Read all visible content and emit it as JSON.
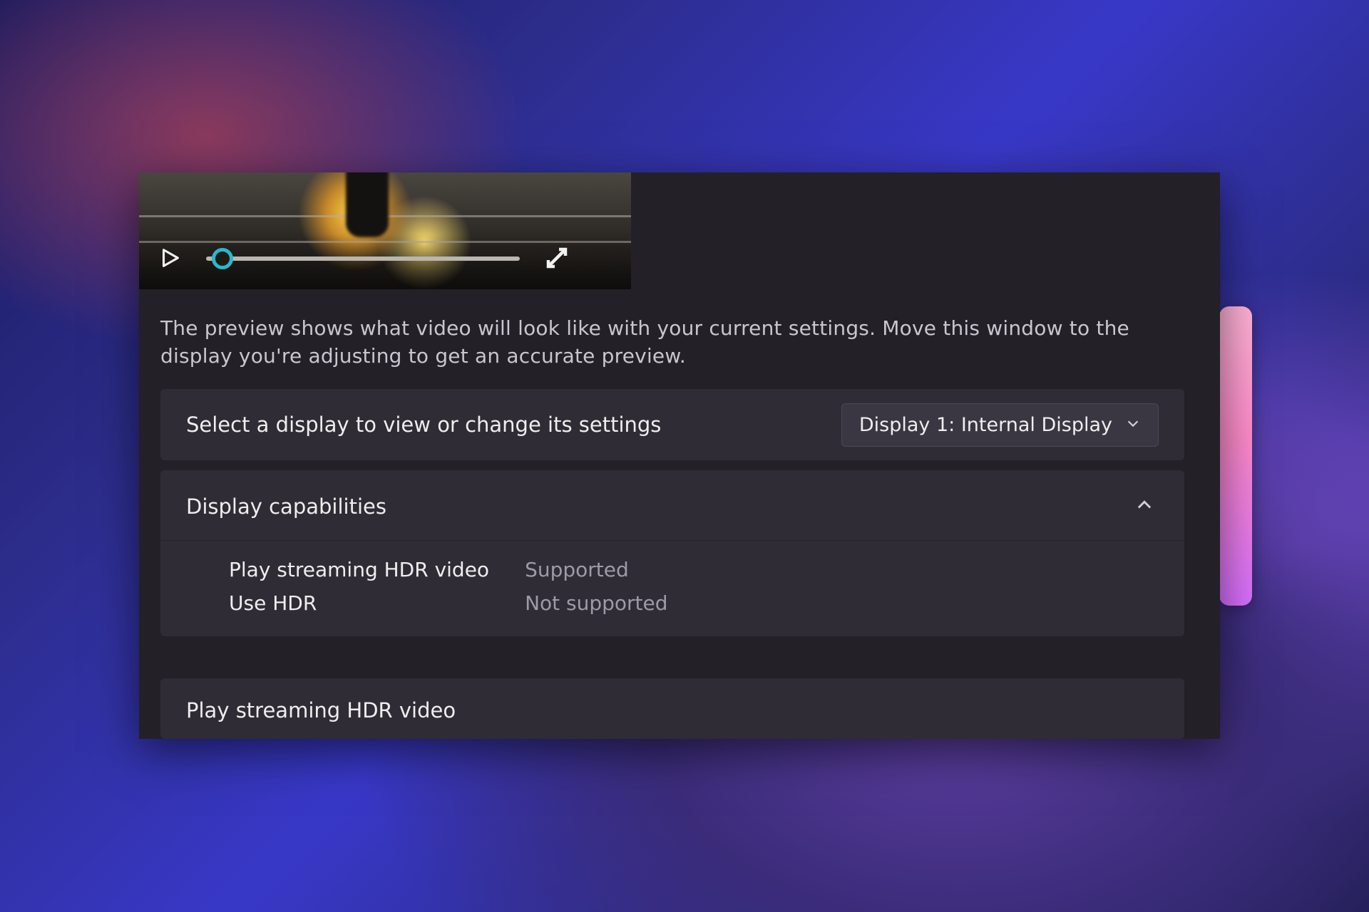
{
  "description": "The preview shows what video will look like with your current settings. Move this window to the display you're adjusting to get an accurate preview.",
  "display_select": {
    "label": "Select a display to view or change its settings",
    "selected": "Display 1: Internal Display"
  },
  "capabilities": {
    "title": "Display capabilities",
    "rows": [
      {
        "key": "Play streaming HDR video",
        "value": "Supported"
      },
      {
        "key": "Use HDR",
        "value": "Not supported"
      }
    ]
  },
  "next_card": {
    "title": "Play streaming HDR video"
  }
}
